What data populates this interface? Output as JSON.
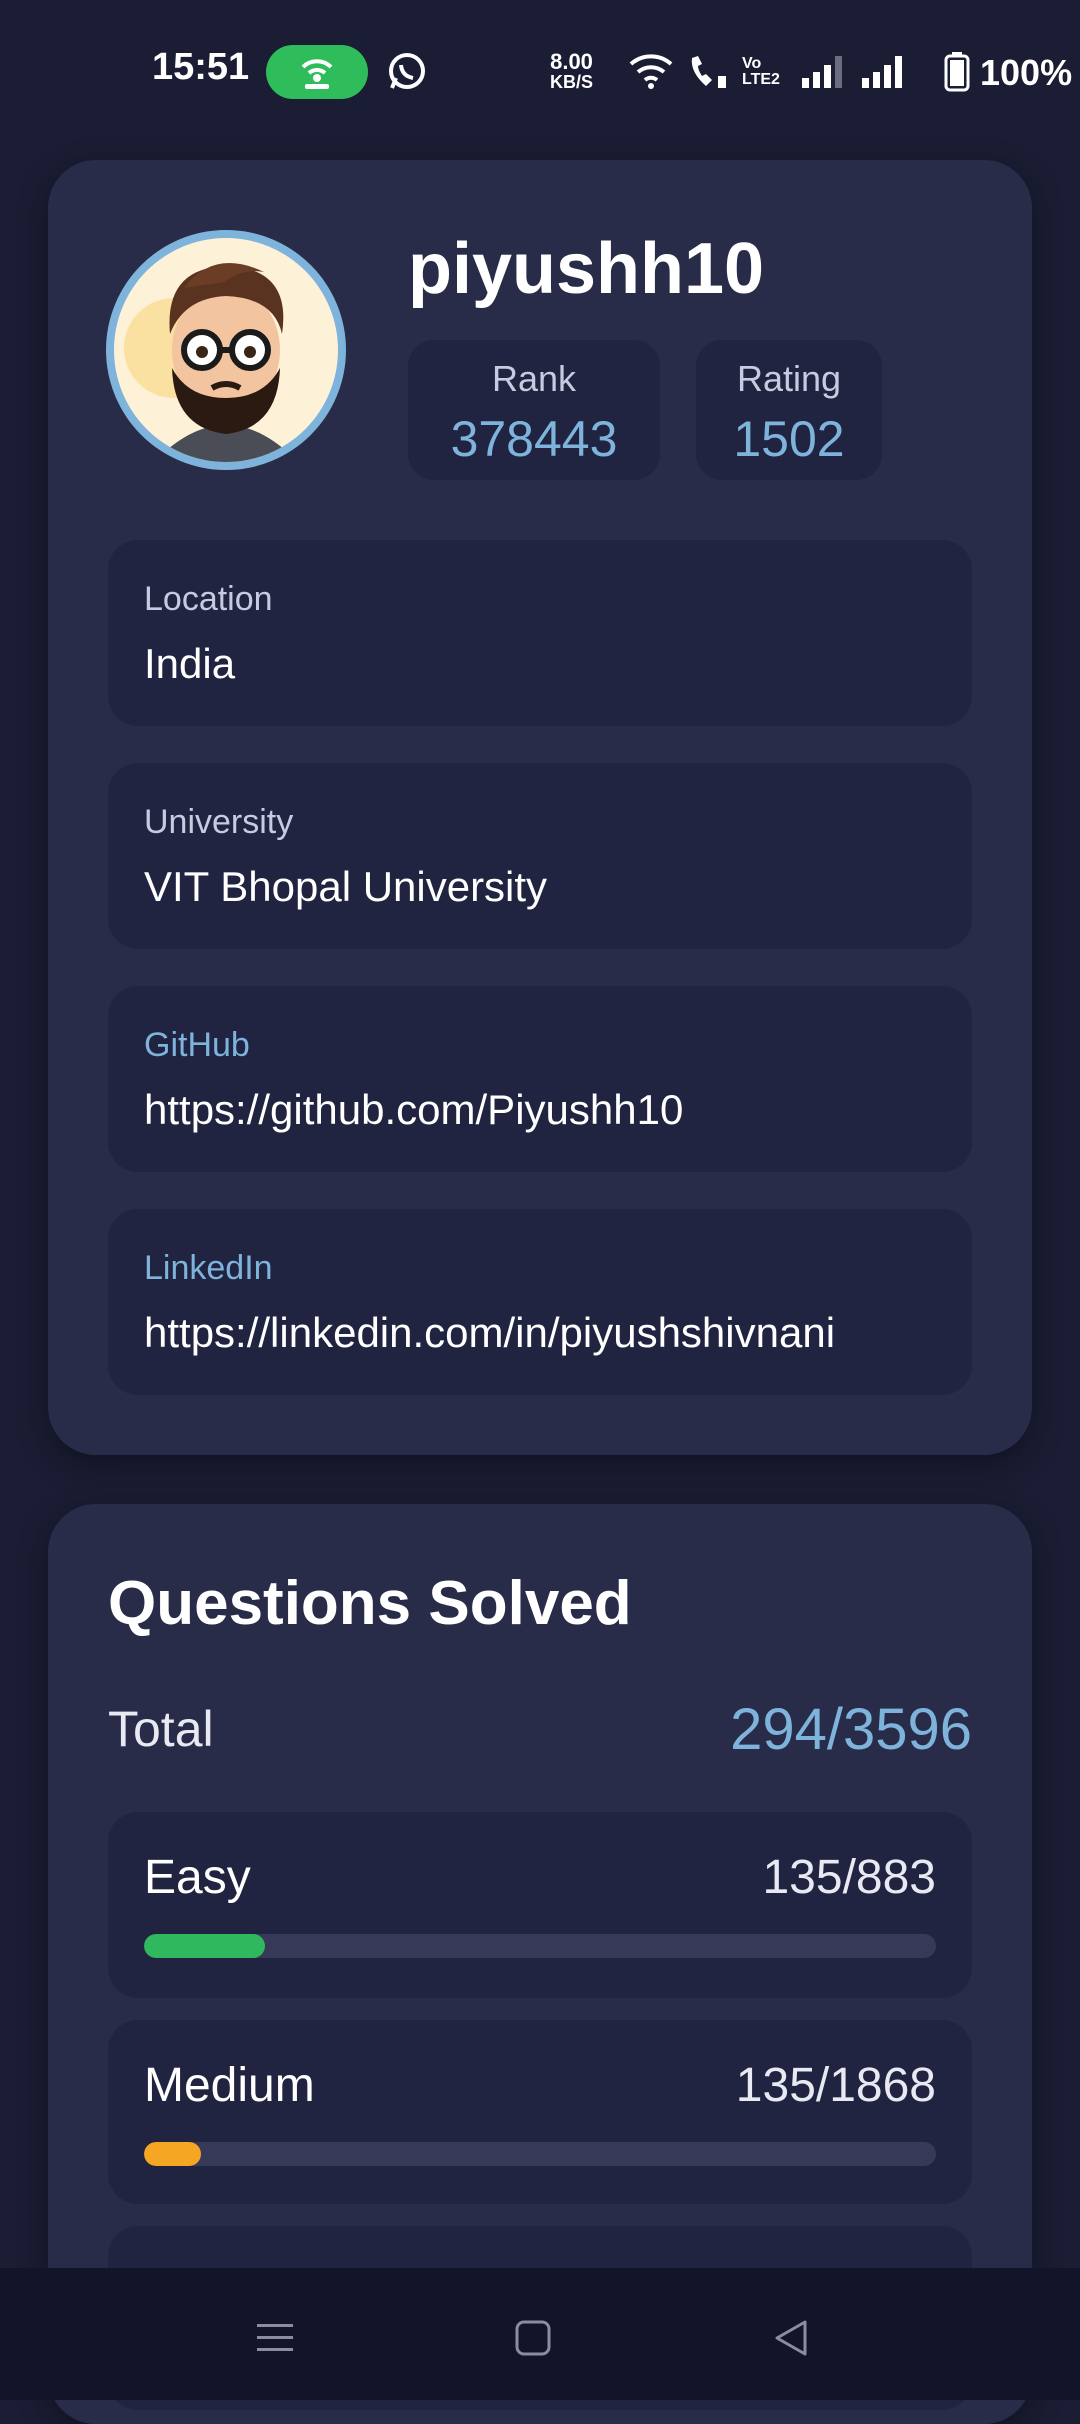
{
  "status_bar": {
    "time": "15:51",
    "net_speed_value": "8.00",
    "net_speed_unit": "KB/S",
    "battery_percent": "100%",
    "icons": [
      "hotspot-icon",
      "whatsapp-icon",
      "wifi-icon",
      "wifi-call-icon",
      "volte-icon",
      "signal-icon",
      "signal-icon",
      "battery-icon"
    ]
  },
  "profile": {
    "username": "piyushh10",
    "rank_label": "Rank",
    "rank_value": "378443",
    "rating_label": "Rating",
    "rating_value": "1502",
    "avatar_icon": "avatar-illustration",
    "fields": [
      {
        "label": "Location",
        "value": "India"
      },
      {
        "label": "University",
        "value": "VIT Bhopal University"
      },
      {
        "label": "GitHub",
        "value": "https://github.com/Piyushh10"
      },
      {
        "label": "LinkedIn",
        "value": "https://linkedin.com/in/piyushshivnani"
      }
    ]
  },
  "questions": {
    "title": "Questions Solved",
    "total_label": "Total",
    "total_value": "294/3596",
    "difficulties": [
      {
        "label": "Easy",
        "value": "135/883",
        "progress": 0.153,
        "color": "#2fb85e"
      },
      {
        "label": "Medium",
        "value": "135/1868",
        "progress": 0.072,
        "color": "#f5a623"
      }
    ]
  },
  "nav_bar": {
    "icons": [
      "menu-icon",
      "home-square-icon",
      "back-triangle-icon"
    ]
  },
  "colors": {
    "background": "#1a1d33",
    "card": "#292c49",
    "inner_box": "#212440",
    "accent": "#7eb3db"
  }
}
